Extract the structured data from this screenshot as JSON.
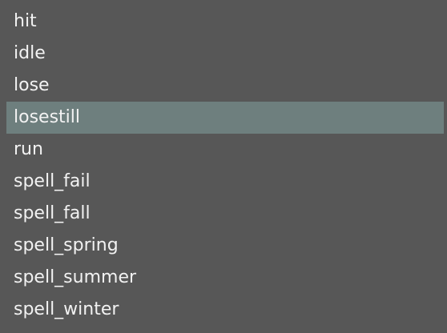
{
  "animation_list": {
    "selected_index": 3,
    "items": [
      {
        "label": "hit"
      },
      {
        "label": "idle"
      },
      {
        "label": "lose"
      },
      {
        "label": "losestill"
      },
      {
        "label": "run"
      },
      {
        "label": "spell_fail"
      },
      {
        "label": "spell_fall"
      },
      {
        "label": "spell_spring"
      },
      {
        "label": "spell_summer"
      },
      {
        "label": "spell_winter"
      }
    ]
  },
  "colors": {
    "background": "#575757",
    "selected_row": "#6e7f7e",
    "text": "#f2f2f2"
  }
}
